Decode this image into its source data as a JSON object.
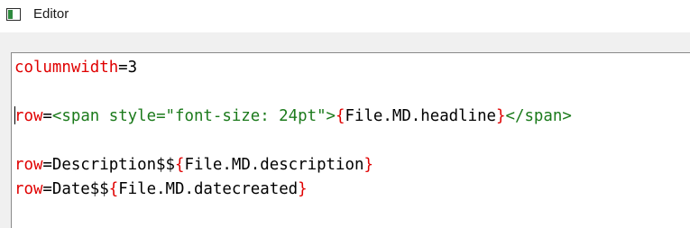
{
  "window": {
    "title": "Editor",
    "icon": "window-app-icon"
  },
  "editor": {
    "lines": [
      [
        {
          "text": "columnwidth",
          "role": "kw"
        },
        {
          "text": "=3",
          "role": "txt"
        }
      ],
      [],
      [
        {
          "text": "row",
          "role": "kw"
        },
        {
          "text": "=",
          "role": "txt"
        },
        {
          "text": "<span style=\"font-size: 24pt\">",
          "role": "tag"
        },
        {
          "text": "{",
          "role": "brace"
        },
        {
          "text": "File.MD.headline",
          "role": "txt"
        },
        {
          "text": "}",
          "role": "brace"
        },
        {
          "text": "</span>",
          "role": "tag"
        }
      ],
      [],
      [
        {
          "text": "row",
          "role": "kw"
        },
        {
          "text": "=Description$$",
          "role": "txt"
        },
        {
          "text": "{",
          "role": "brace"
        },
        {
          "text": "File.MD.description",
          "role": "txt"
        },
        {
          "text": "}",
          "role": "brace"
        }
      ],
      [
        {
          "text": "row",
          "role": "kw"
        },
        {
          "text": "=Date$$",
          "role": "txt"
        },
        {
          "text": "{",
          "role": "brace"
        },
        {
          "text": "File.MD.datecreated",
          "role": "txt"
        },
        {
          "text": "}",
          "role": "brace"
        }
      ]
    ],
    "caret_line": 2,
    "colors": {
      "keyword": "#e00000",
      "tag": "#1b7a1b",
      "text": "#000000",
      "background": "#ffffff"
    }
  }
}
